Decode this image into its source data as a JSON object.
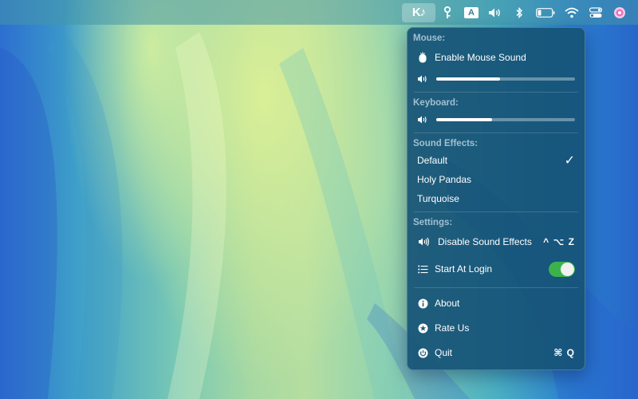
{
  "menubar": {
    "app_icon_text": "K♪",
    "input_source": "A"
  },
  "menu": {
    "mouse": {
      "heading": "Mouse:",
      "enable_label": "Enable Mouse Sound",
      "volume": 0.46
    },
    "keyboard": {
      "heading": "Keyboard:",
      "volume": 0.4
    },
    "sound_effects": {
      "heading": "Sound Effects:",
      "options": [
        "Default",
        "Holy Pandas",
        "Turquoise"
      ],
      "selected": "Default",
      "check_mark": "✓"
    },
    "settings": {
      "heading": "Settings:",
      "disable_label": "Disable Sound Effects",
      "disable_shortcut": "^ ⌥ Z",
      "start_login_label": "Start At Login",
      "start_login_on": true
    },
    "about_label": "About",
    "rate_label": "Rate Us",
    "quit_label": "Quit",
    "quit_shortcut": "⌘ Q"
  },
  "colors": {
    "menu_bg": "#16527695",
    "toggle_on": "#3bb34a"
  }
}
